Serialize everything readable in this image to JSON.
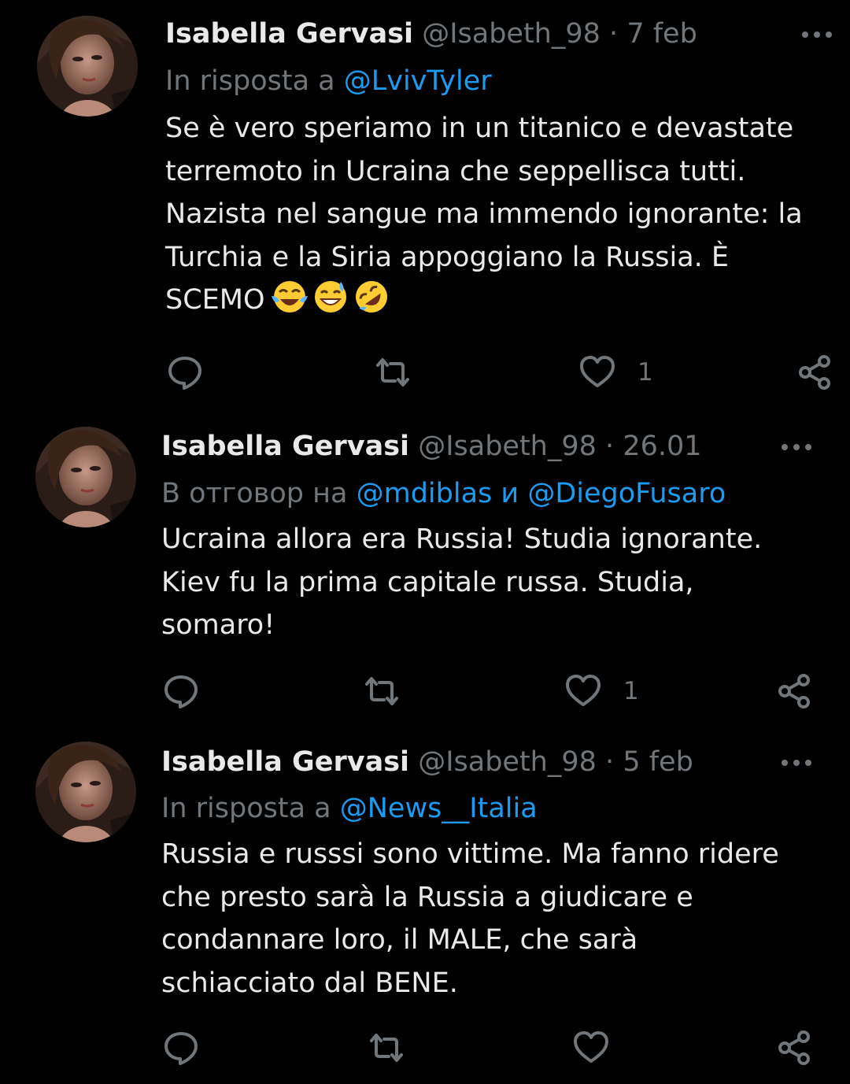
{
  "colors": {
    "background": "#000000",
    "text": "#e7e9ea",
    "secondary": "#71767b",
    "accent": "#1d9bf0"
  },
  "tweets": [
    {
      "author_name": "Isabella Gervasi",
      "handle": "@Isabeth_98",
      "separator": "·",
      "date": "7 feb",
      "reply_prefix": "In risposta a",
      "reply_to": "@LvivTyler",
      "reply_joiner": "",
      "reply_to_second": "",
      "body_lines": [
        "Se è vero speriamo in un titanico e devastate",
        "terremoto in Ucraina che seppellisca tutti.",
        "Nazista nel sangue ma immendo ignorante: la",
        "Turchia e la Siria appoggiano la Russia. È",
        "SCEMO"
      ],
      "emojis": [
        "face-with-tears-of-joy",
        "grinning-face-with-sweat",
        "rolling-on-the-floor-laughing"
      ],
      "reply_count": "",
      "retweet_count": "",
      "like_count": "1",
      "icons": [
        "more-icon",
        "reply-icon",
        "retweet-icon",
        "like-icon",
        "share-icon"
      ]
    },
    {
      "author_name": "Isabella Gervasi",
      "handle": "@Isabeth_98",
      "separator": "·",
      "date": "26.01",
      "reply_prefix": "В отговор на",
      "reply_to": "@mdiblas",
      "reply_joiner": "и",
      "reply_to_second": "@DiegoFusaro",
      "body_lines": [
        "Ucraina allora era Russia! Studia ignorante.",
        "Kiev fu la prima capitale russa. Studia,",
        "somaro!"
      ],
      "emojis": [],
      "reply_count": "",
      "retweet_count": "",
      "like_count": "1",
      "icons": [
        "more-icon",
        "reply-icon",
        "retweet-icon",
        "like-icon",
        "share-icon"
      ]
    },
    {
      "author_name": "Isabella Gervasi",
      "handle": "@Isabeth_98",
      "separator": "·",
      "date": "5 feb",
      "reply_prefix": "In risposta a",
      "reply_to": "@News__Italia",
      "reply_joiner": "",
      "reply_to_second": "",
      "body_lines": [
        "Russia e russsi sono vittime. Ma fanno ridere",
        "che presto sarà la Russia a giudicare e",
        "condannare loro, il MALE, che sarà",
        "schiacciato dal BENE."
      ],
      "emojis": [],
      "reply_count": "",
      "retweet_count": "",
      "like_count": "",
      "icons": [
        "more-icon",
        "reply-icon",
        "retweet-icon",
        "like-icon",
        "share-icon"
      ]
    }
  ]
}
